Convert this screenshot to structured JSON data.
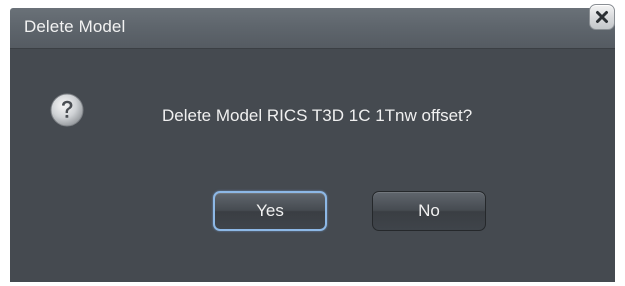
{
  "dialog": {
    "title": "Delete Model",
    "message": "Delete Model RICS T3D 1C 1Tnw offset?",
    "buttons": {
      "yes_label": "Yes",
      "no_label": "No"
    },
    "icons": {
      "question": "question-icon",
      "close": "close-icon"
    },
    "colors": {
      "titlebar": "#5f666d",
      "body": "#454a50",
      "text": "#f0f0f0",
      "focus_ring": "#8db8e6"
    }
  }
}
